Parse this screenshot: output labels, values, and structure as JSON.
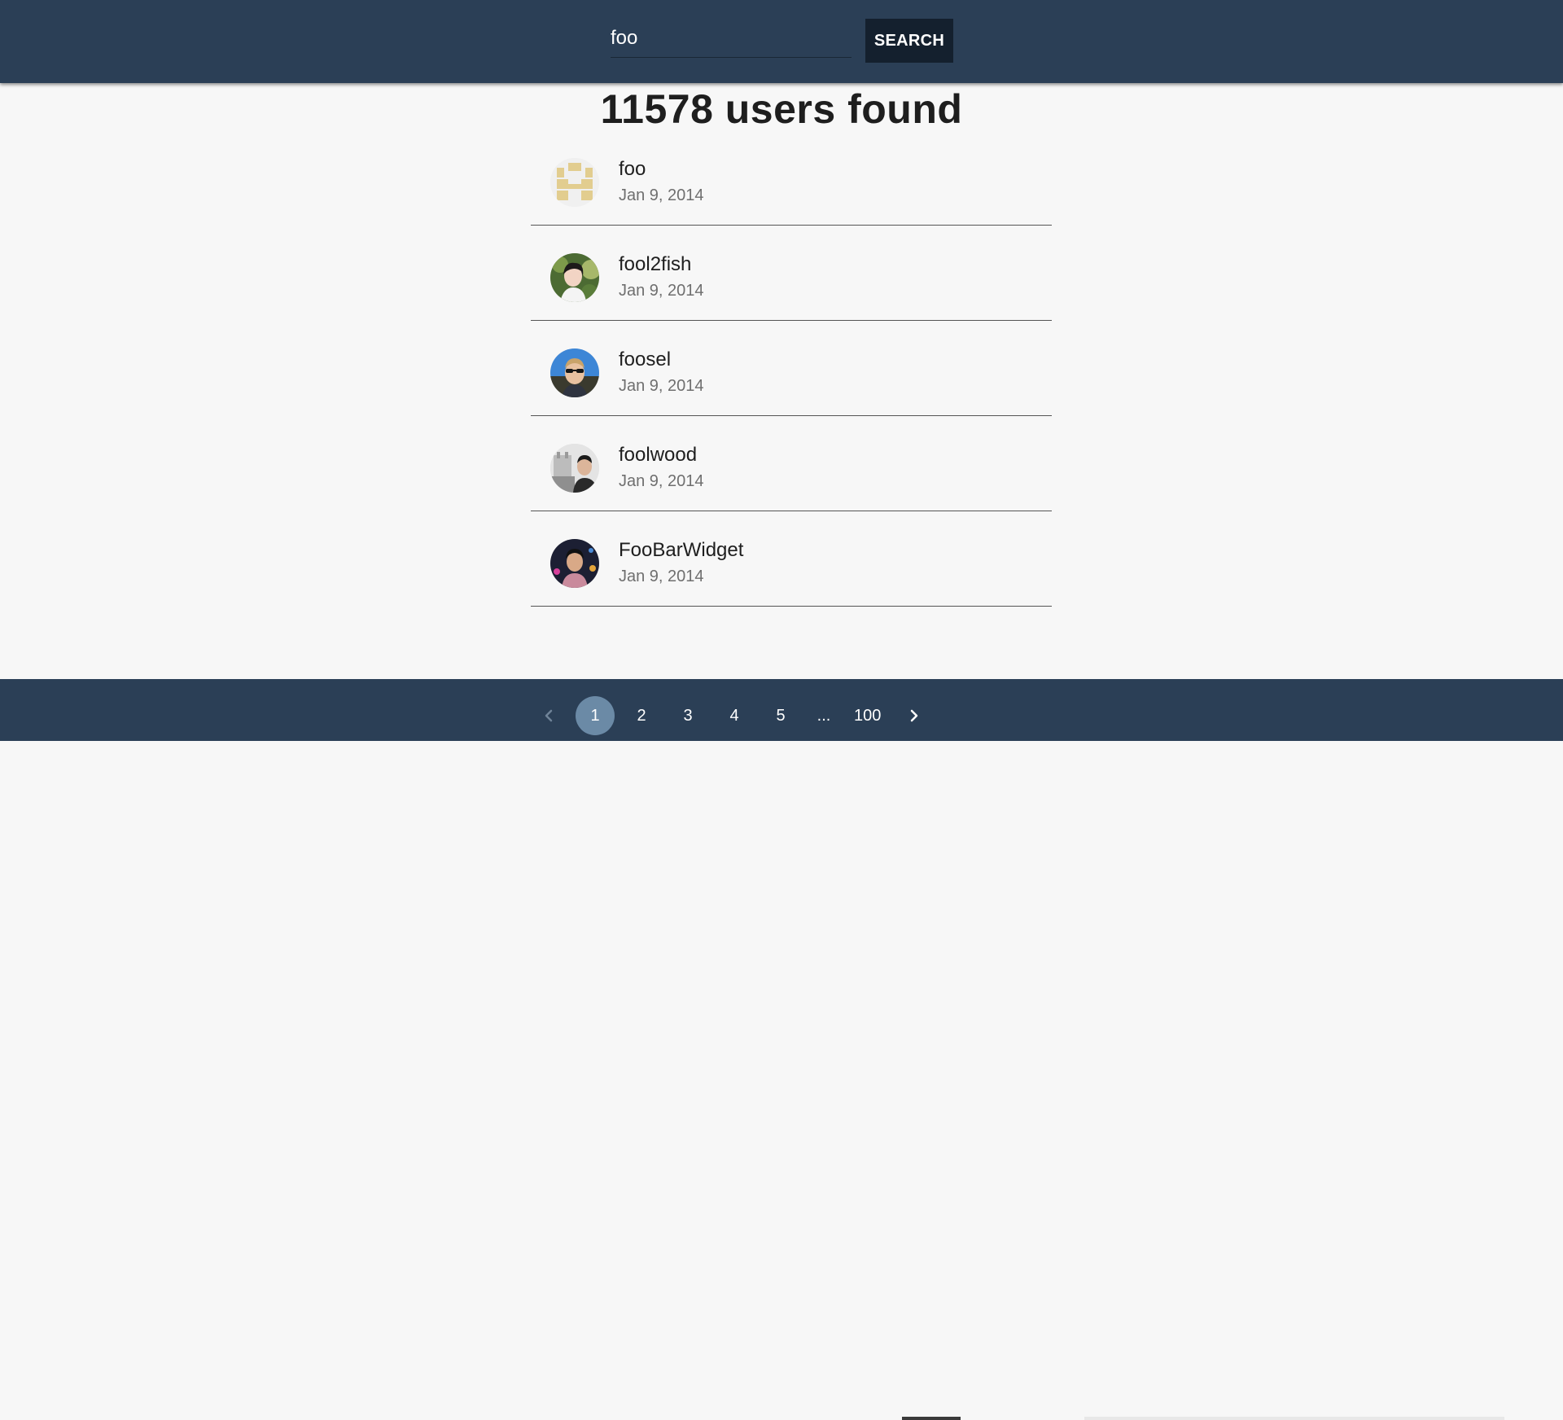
{
  "search": {
    "value": "foo",
    "placeholder": "",
    "button_label": "SEARCH"
  },
  "results": {
    "title": "11578 users found",
    "users": [
      {
        "name": "foo",
        "date": "Jan 9, 2014",
        "avatar": "identicon-avatar"
      },
      {
        "name": "fool2fish",
        "date": "Jan 9, 2014",
        "avatar": "photo-avatar"
      },
      {
        "name": "foosel",
        "date": "Jan 9, 2014",
        "avatar": "photo-avatar"
      },
      {
        "name": "foolwood",
        "date": "Jan 9, 2014",
        "avatar": "photo-avatar"
      },
      {
        "name": "FooBarWidget",
        "date": "Jan 9, 2014",
        "avatar": "photo-avatar"
      }
    ]
  },
  "pagination": {
    "prev_icon": "chevron-left-icon",
    "next_icon": "chevron-right-icon",
    "pages": [
      "1",
      "2",
      "3",
      "4",
      "5"
    ],
    "ellipsis": "...",
    "last_page": "100",
    "current_page": "1"
  },
  "colors": {
    "header_bg": "#2b3f56",
    "button_bg": "#14202e",
    "page_bg": "#f7f7f7",
    "current_page_bg": "#6b8aa6",
    "identicon_color": "#e2cd8f"
  }
}
